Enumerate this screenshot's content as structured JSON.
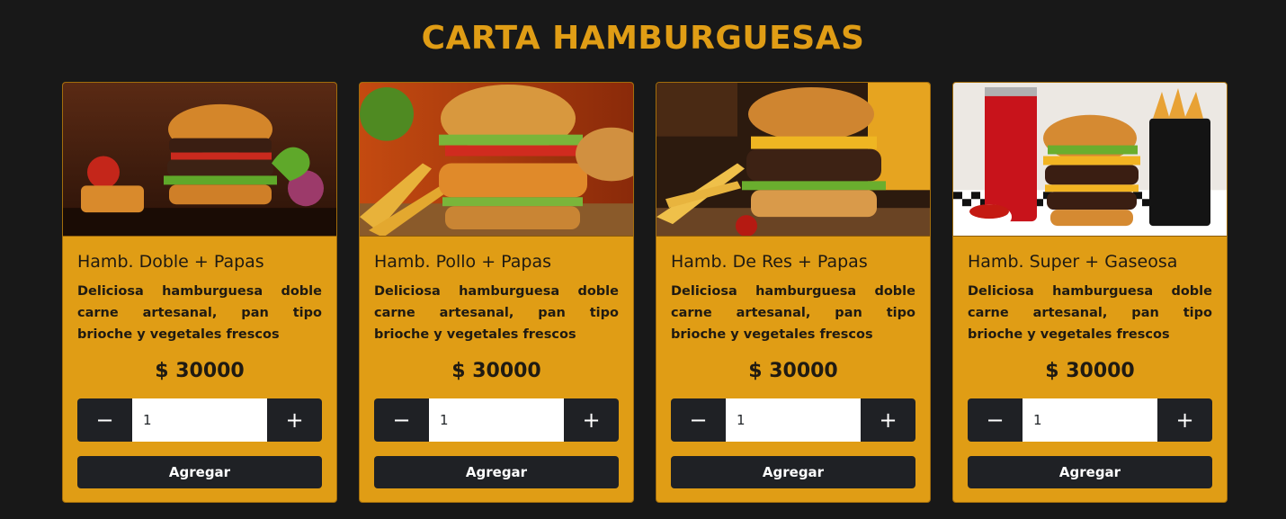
{
  "page": {
    "title": "CARTA HAMBURGUESAS",
    "accent_color": "#e09d15",
    "background_color": "#181818"
  },
  "cards": [
    {
      "image_icon": "burger-double-photo",
      "title": "Hamb. Doble + Papas",
      "description": "Deliciosa hamburguesa doble carne artesanal, pan tipo brioche y vegetales frescos",
      "price": "$ 30000",
      "quantity": "1",
      "minus_label": "−",
      "plus_label": "+",
      "add_label": "Agregar"
    },
    {
      "image_icon": "burger-chicken-photo",
      "title": "Hamb. Pollo + Papas",
      "description": "Deliciosa hamburguesa doble carne artesanal, pan tipo brioche y vegetales frescos",
      "price": "$ 30000",
      "quantity": "1",
      "minus_label": "−",
      "plus_label": "+",
      "add_label": "Agregar"
    },
    {
      "image_icon": "burger-beef-photo",
      "title": "Hamb. De Res + Papas",
      "description": "Deliciosa hamburguesa doble carne artesanal, pan tipo brioche y vegetales frescos",
      "price": "$ 30000",
      "quantity": "1",
      "minus_label": "−",
      "plus_label": "+",
      "add_label": "Agregar"
    },
    {
      "image_icon": "burger-soda-combo-photo",
      "title": "Hamb. Super + Gaseosa",
      "description": "Deliciosa hamburguesa doble carne artesanal, pan tipo brioche y vegetales frescos",
      "price": "$ 30000",
      "quantity": "1",
      "minus_label": "−",
      "plus_label": "+",
      "add_label": "Agregar"
    }
  ]
}
